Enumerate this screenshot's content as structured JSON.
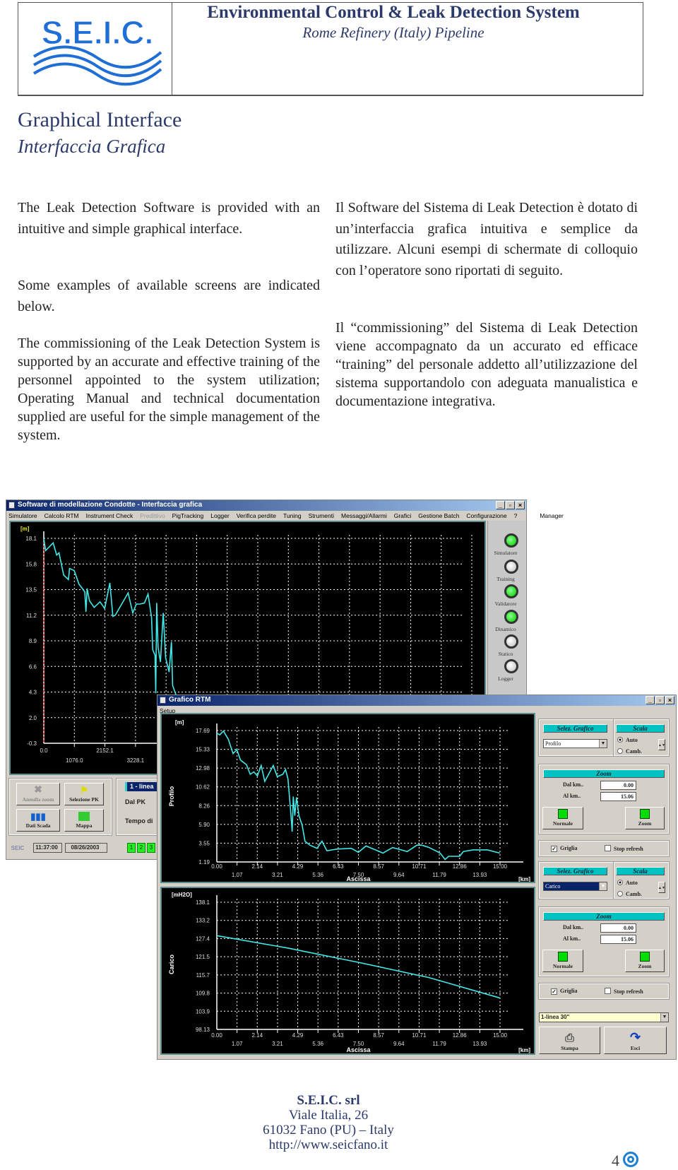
{
  "header": {
    "logo_text": "S.E.I.C.",
    "title": "Environmental Control & Leak Detection System",
    "subtitle": "Rome Refinery (Italy) Pipeline",
    "logo_color": "#1e6ed6"
  },
  "section": {
    "title": "Graphical Interface",
    "title_it": "Interfaccia Grafica"
  },
  "left_column": [
    "The Leak Detection Software is provided with an intuitive and simple graphical interface.",
    "Some examples of available screens are indicated below.",
    "The commissioning of the Leak Detection System is supported by an accurate and effective training of the personnel appointed to the system utilization; Operating Manual and technical documentation supplied are useful for the simple management of the system."
  ],
  "right_column": [
    "Il Software del Sistema di Leak Detection è dotato di un’interfaccia grafica intuitiva e semplice da utilizzare. Alcuni esempi di schermate di colloquio con l’operatore sono riportati di seguito.",
    "Il “commissioning” del Sistema di Leak Detection viene accompagnato da un accurato ed efficace “training” del personale addetto all’utilizzazione del sistema supportandolo con adeguata manualistica e documentazione integrativa."
  ],
  "main_window": {
    "title": "Software di modellazione Condotte - Interfaccia grafica",
    "window_buttons": [
      "_",
      "▫",
      "×"
    ],
    "menu": [
      "Simulatore",
      "Calcolo RTM",
      "Instrument Check",
      "Predittivo",
      "PigTracking",
      "Logger",
      "Verifica perdite",
      "Tuning",
      "Strumenti",
      "Messaggi/Allarmi",
      "Grafici",
      "Gestione Batch",
      "Configurazione",
      "?",
      "Manager"
    ],
    "menu_disabled": "Predittivo",
    "leds": [
      {
        "label": "Simulatore",
        "on": true
      },
      {
        "label": "Training",
        "on": false
      },
      {
        "label": "Validatore",
        "on": true
      },
      {
        "label": "Dinamico",
        "on": true
      },
      {
        "label": "Statico",
        "on": false
      },
      {
        "label": "Logger",
        "on": false
      }
    ],
    "buttons": {
      "undo_zoom": "Annulla zoom",
      "select_pk": "Selezione PK",
      "scada": "Dati Scada",
      "map": "Mappa"
    },
    "info": {
      "line": "1 - linea",
      "from_pk": "Dal PK",
      "time": "Tempo di"
    },
    "status": {
      "time": "11:37:00",
      "date": "08/26/2003",
      "indicators": [
        "1",
        "2",
        "3"
      ]
    }
  },
  "rtm_window": {
    "title": "Grafico RTM",
    "window_buttons": [
      "_",
      "▫",
      "×"
    ],
    "menu": [
      "Setup"
    ],
    "panels": [
      {
        "select_header": "Selez. Grafico",
        "select_value": "Profilo",
        "scale_header": "Scala",
        "auto": "Auto",
        "change": "Camb.",
        "scale_mode": "Auto",
        "zoom_header": "Zoom",
        "from_label": "Dal km..",
        "from_value": "0.00",
        "to_label": "Al km..",
        "to_value": "15.06",
        "normal": "Normale",
        "zoom": "Zoom",
        "grid": "Griglia",
        "grid_checked": true,
        "stop": "Stop refresh",
        "stop_checked": false
      },
      {
        "select_header": "Selez. Grafico",
        "select_value": "Carico",
        "scale_header": "Scala",
        "auto": "Auto",
        "change": "Camb.",
        "scale_mode": "Auto",
        "zoom_header": "Zoom",
        "from_label": "Dal km..",
        "from_value": "0.00",
        "to_label": "Al km..",
        "to_value": "15.06",
        "normal": "Normale",
        "zoom": "Zoom",
        "grid": "Griglia",
        "grid_checked": true,
        "stop": "Stop refresh",
        "stop_checked": false
      }
    ],
    "line_select": "1-linea 30\"",
    "print": "Stampa",
    "exit": "Esci"
  },
  "chart_data": [
    {
      "type": "line",
      "unit": "[m]",
      "color": "#40e8e8",
      "grid": true,
      "xlim": [
        0,
        15064
      ],
      "ylim": [
        -0.3,
        18.1
      ],
      "x_ticks": [
        "0.0",
        "1076.0",
        "2152.1",
        "3228.1"
      ],
      "y_ticks": [
        "18.1",
        "15.8",
        "13.5",
        "11.2",
        "8.9",
        "6.6",
        "4.3",
        "2.0",
        "-0.3"
      ],
      "x": [
        0,
        66,
        330,
        453,
        536,
        700,
        866,
        907,
        1072,
        1237,
        1443,
        1484,
        1525,
        1608,
        1773,
        1979,
        2144,
        2325,
        2432,
        2515,
        2968,
        3133,
        3257,
        3380,
        3545,
        3669,
        3793,
        3834,
        3916,
        3941,
        3974,
        4023,
        4106,
        4205,
        4287,
        4411,
        4493,
        4535,
        4658,
        4782
      ],
      "y": [
        18.1,
        17.0,
        17.7,
        16.6,
        16.8,
        14.8,
        14.4,
        15.4,
        15.2,
        14.0,
        13.3,
        11.5,
        13.6,
        12.5,
        11.9,
        12.4,
        11.8,
        14.1,
        11.1,
        11.2,
        13.2,
        11.4,
        12.2,
        12.2,
        12.3,
        13.1,
        11.0,
        8.1,
        7.6,
        4.2,
        12.3,
        8.3,
        7.0,
        11.4,
        7.4,
        6.1,
        8.8,
        4.9,
        4.0,
        2.8
      ]
    },
    {
      "type": "line",
      "ylabel": "Profilo",
      "unit": "[m]",
      "xlabel": "Ascissa",
      "xunit": "[km]",
      "color": "#40e8e8",
      "grid": true,
      "xlim": [
        0,
        15
      ],
      "ylim": [
        1.19,
        17.69
      ],
      "x_ticks": [
        "0.00",
        "1.07",
        "2.14",
        "3.21",
        "4.29",
        "5.36",
        "6.43",
        "7.50",
        "8.57",
        "9.64",
        "10.71",
        "11.79",
        "12.86",
        "13.93",
        "15.00"
      ],
      "y_ticks": [
        "17.69",
        "15.33",
        "12.98",
        "10.62",
        "8.26",
        "5.90",
        "3.55",
        "1.19"
      ],
      "x": [
        0,
        0.15,
        0.35,
        0.61,
        0.86,
        1.06,
        1.25,
        1.57,
        1.77,
        1.96,
        2.15,
        2.35,
        2.54,
        2.99,
        3.2,
        3.5,
        3.64,
        3.77,
        3.9,
        3.99,
        4.05,
        4.13,
        4.22,
        4.35,
        4.52,
        4.67,
        4.93,
        5.31,
        5.57,
        5.83,
        6.35,
        7.12,
        7.5,
        7.9,
        8.41,
        8.8,
        9.31,
        10.09,
        10.6,
        10.86,
        11.25,
        11.83,
        12.09,
        12.28,
        12.86,
        13.06,
        13.57,
        14.34,
        14.99
      ],
      "y": [
        17.38,
        17.14,
        17.63,
        16.6,
        14.8,
        15.3,
        14.0,
        13.4,
        12.2,
        12.5,
        12.0,
        13.3,
        11.3,
        13.3,
        11.9,
        12.2,
        12.8,
        11.6,
        7.9,
        5.0,
        9.4,
        7.0,
        9.3,
        7.0,
        5.8,
        3.8,
        3.3,
        2.9,
        3.8,
        2.6,
        2.8,
        2.9,
        2.4,
        3.2,
        2.7,
        2.3,
        3.0,
        2.5,
        3.3,
        3.3,
        3.0,
        2.3,
        1.5,
        1.9,
        1.9,
        2.5,
        2.7,
        2.7,
        2.3
      ]
    },
    {
      "type": "line",
      "ylabel": "Carico",
      "unit": "[mH2O]",
      "xlabel": "Ascissa",
      "xunit": "[km]",
      "color": "#40e8e8",
      "grid": true,
      "xlim": [
        0,
        15
      ],
      "ylim": [
        98.13,
        138.1
      ],
      "x_ticks": [
        "0.00",
        "1.07",
        "2.14",
        "3.21",
        "4.29",
        "5.36",
        "6.43",
        "7.50",
        "8.57",
        "9.64",
        "10.71",
        "11.79",
        "12.86",
        "13.93",
        "15.00"
      ],
      "y_ticks": [
        "138.1",
        "133.2",
        "127.4",
        "121.5",
        "115.7",
        "109.8",
        "103.9",
        "98.13"
      ],
      "x": [
        0,
        3.75,
        7.5,
        11.25,
        15
      ],
      "y": [
        127.6,
        123.7,
        119.2,
        114.4,
        108.0
      ]
    }
  ],
  "footer": {
    "company": "S.E.I.C. srl",
    "address": "Viale Italia, 26",
    "city": "61032 Fano (PU) – Italy",
    "web": "http://www.seicfano.it",
    "page": "4"
  }
}
